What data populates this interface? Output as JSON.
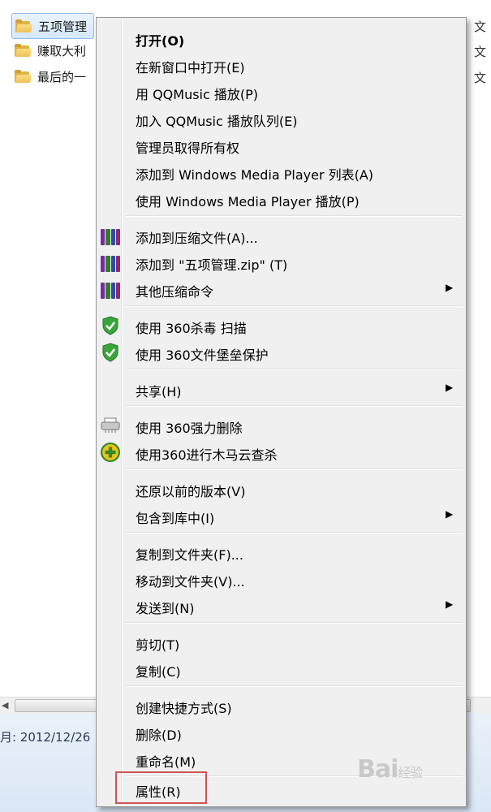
{
  "explorer": {
    "files": [
      {
        "name": "五项管理",
        "type": "文",
        "selected": true
      },
      {
        "name": "赚取大利",
        "type": "文",
        "selected": false
      },
      {
        "name": "最后的一",
        "type": "文",
        "selected": false
      }
    ],
    "status_date": "月: 2012/12/26"
  },
  "menu": {
    "items": [
      {
        "label": "打开(O)"
      },
      {
        "label": "在新窗口中打开(E)"
      },
      {
        "label": "用 QQMusic 播放(P)"
      },
      {
        "label": "加入 QQMusic 播放队列(E)"
      },
      {
        "label": "管理员取得所有权"
      },
      {
        "label": "添加到 Windows Media Player 列表(A)"
      },
      {
        "label": "使用 Windows Media Player 播放(P)"
      },
      {
        "label": "添加到压缩文件(A)...",
        "icon": "winrar-books-icon"
      },
      {
        "label": "添加到 \"五项管理.zip\" (T)",
        "icon": "winrar-books-icon"
      },
      {
        "label": "其他压缩命令",
        "icon": "winrar-books-icon",
        "submenu": true
      },
      {
        "label": "使用 360杀毒 扫描",
        "icon": "360-shield-icon"
      },
      {
        "label": "使用 360文件堡垒保护",
        "icon": "360-shield-icon"
      },
      {
        "label": "共享(H)",
        "submenu": true
      },
      {
        "label": "使用 360强力删除",
        "icon": "shredder-icon"
      },
      {
        "label": "使用360进行木马云查杀",
        "icon": "360-cloud-scan-icon"
      },
      {
        "label": "还原以前的版本(V)"
      },
      {
        "label": "包含到库中(I)",
        "submenu": true
      },
      {
        "label": "复制到文件夹(F)..."
      },
      {
        "label": "移动到文件夹(V)..."
      },
      {
        "label": "发送到(N)",
        "submenu": true
      },
      {
        "label": "剪切(T)"
      },
      {
        "label": "复制(C)"
      },
      {
        "label": "创建快捷方式(S)"
      },
      {
        "label": "删除(D)"
      },
      {
        "label": "重命名(M)"
      },
      {
        "label": "属性(R)",
        "highlighted": true
      }
    ],
    "submenu_arrow": "▶"
  },
  "watermark": {
    "text": "Bai",
    "suffix": "经验"
  },
  "colors": {
    "menu_bg": "#f0f0f0",
    "highlight_border": "#d05252",
    "selection_bg": "#d4e7fb"
  }
}
